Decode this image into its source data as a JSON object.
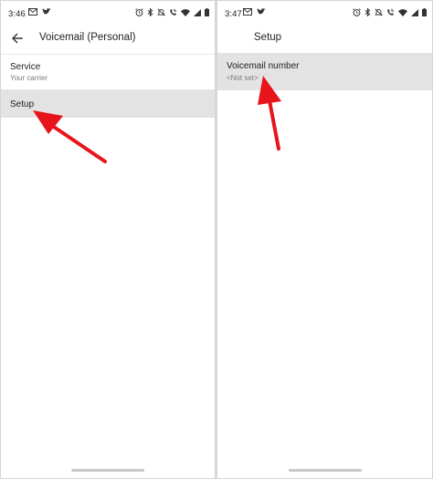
{
  "left_screen": {
    "status_time": "3:46",
    "status_icons_left": [
      "gmail-icon",
      "twitter-icon"
    ],
    "status_icons_right": [
      "alarm-icon",
      "bluetooth-icon",
      "mute-icon",
      "wifi-calling-icon",
      "wifi-icon",
      "signal-icon",
      "battery-icon"
    ],
    "title": "Voicemail (Personal)",
    "items": [
      {
        "title": "Service",
        "summary": "Your carrier"
      },
      {
        "title": "Setup",
        "summary": ""
      }
    ],
    "highlighted_item": "Setup"
  },
  "right_screen": {
    "status_time": "3:47",
    "status_icons_left": [
      "gmail-icon",
      "twitter-icon"
    ],
    "status_icons_right": [
      "alarm-icon",
      "bluetooth-icon",
      "mute-icon",
      "wifi-calling-icon",
      "wifi-icon",
      "signal-icon",
      "battery-icon"
    ],
    "title": "Setup",
    "items": [
      {
        "title": "Voicemail number",
        "summary": "<Not set>"
      }
    ],
    "highlighted_item": "Voicemail number"
  },
  "colors": {
    "annotation_arrow": "#e8141b",
    "highlight_row": "#e3e3e3"
  }
}
